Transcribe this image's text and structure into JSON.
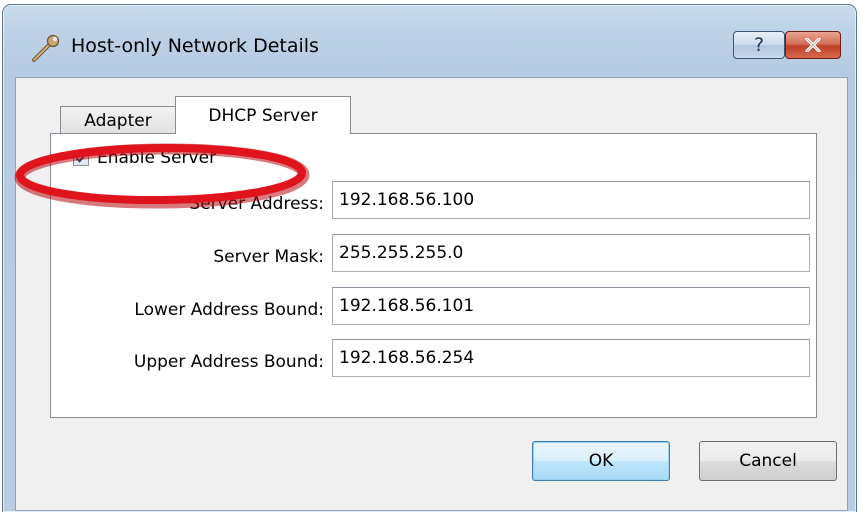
{
  "window": {
    "title": "Host-only Network Details",
    "help_glyph": "?",
    "close_glyph": "✕"
  },
  "tabs": [
    {
      "label": "Adapter",
      "active": false
    },
    {
      "label": "DHCP Server",
      "active": true
    }
  ],
  "dhcp": {
    "enable_label": "Enable Server",
    "enable_checked": true,
    "fields": [
      {
        "label": "Server Address:",
        "value": "192.168.56.100"
      },
      {
        "label": "Server Mask:",
        "value": "255.255.255.0"
      },
      {
        "label": "Lower Address Bound:",
        "value": "192.168.56.101"
      },
      {
        "label": "Upper Address Bound:",
        "value": "192.168.56.254"
      }
    ]
  },
  "buttons": {
    "ok": "OK",
    "cancel": "Cancel"
  },
  "icons": {
    "title": "wrench-icon",
    "help": "help-icon",
    "close": "close-icon",
    "check": "checkmark-icon"
  },
  "colors": {
    "annotation_ellipse": "#e0141c",
    "close_button": "#c7432b",
    "ok_button_border": "#3c7fb1"
  }
}
